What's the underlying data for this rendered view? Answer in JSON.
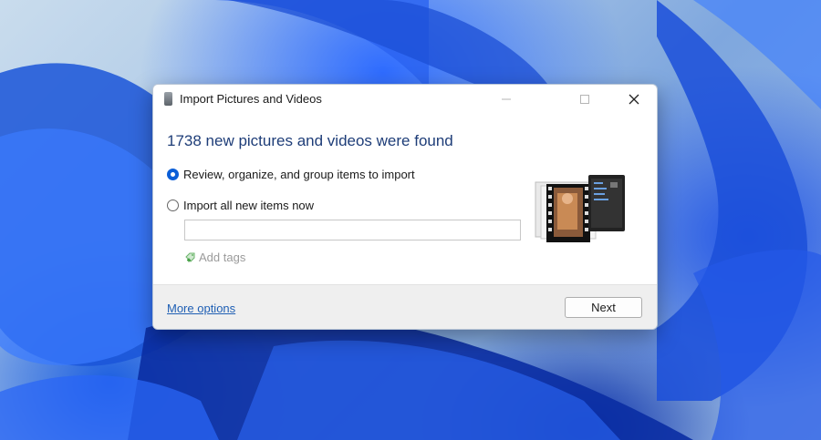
{
  "window": {
    "title": "Import Pictures and Videos",
    "minimize_icon": "minimize-icon",
    "maximize_icon": "maximize-icon",
    "close_icon": "close-icon"
  },
  "content": {
    "headline": "1738 new pictures and videos were found",
    "options": [
      {
        "label": "Review, organize, and group items to import",
        "selected": true
      },
      {
        "label": "Import all new items now",
        "selected": false
      }
    ],
    "tags_input": {
      "value": "",
      "placeholder": ""
    },
    "add_tags_label": "Add tags",
    "media_icon": "photo-film-stack-icon"
  },
  "footer": {
    "more_options_link": "More options",
    "next_button": "Next"
  },
  "colors": {
    "headline": "#1e3d78",
    "link": "#1f5fb4",
    "radio_selected": "#0b5ed7",
    "wallpaper_blue": "#1d5fe0"
  }
}
